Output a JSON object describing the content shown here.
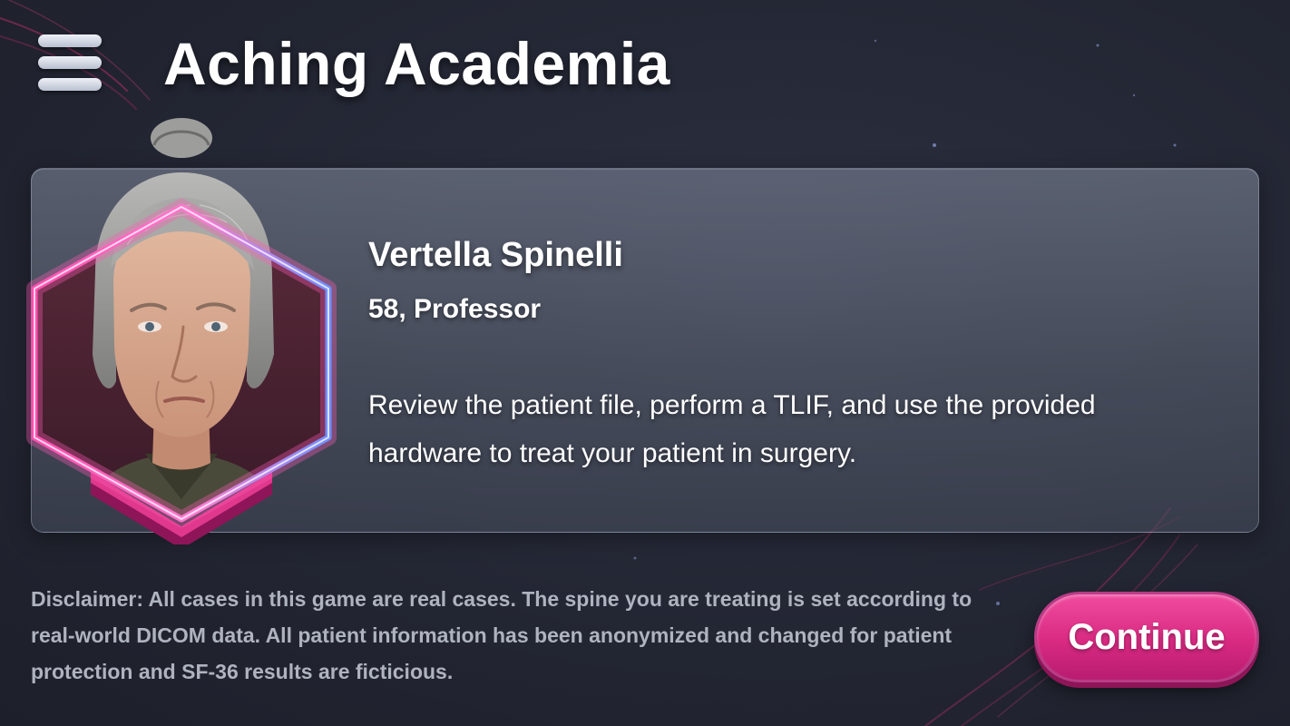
{
  "header": {
    "menu_icon": "hamburger-menu-icon",
    "title": "Aching Academia"
  },
  "patient": {
    "name": "Vertella Spinelli",
    "subtitle": "58, Professor",
    "portrait": "patient-portrait",
    "instructions": "Review the patient file, perform a TLIF, and use the provided hardware to treat your patient in surgery."
  },
  "footer": {
    "disclaimer": "Disclaimer: All cases in this game are real cases. The spine you are treating is set according to real-world DICOM data. All patient information has been anonymized and changed for patient protection and SF-36 results are ficticious.",
    "continue_label": "Continue"
  },
  "colors": {
    "background": "#232633",
    "accent_pink": "#e03a8c",
    "frame_blue": "#7f9cff",
    "card": "#6b7284",
    "disclaimer_text": "#aeb3bf"
  }
}
